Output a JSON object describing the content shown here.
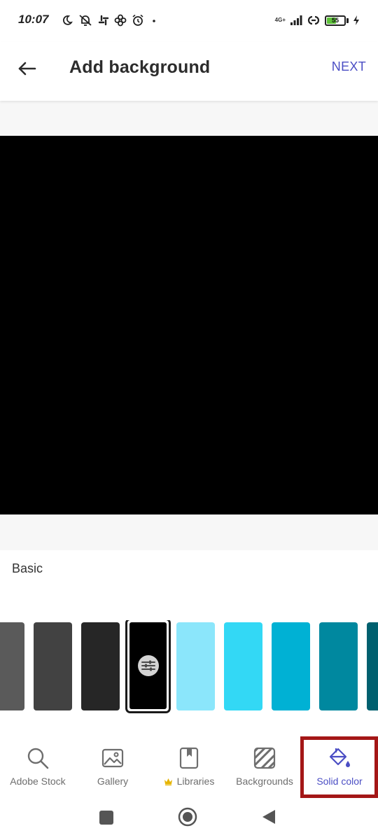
{
  "status_bar": {
    "time": "10:07",
    "network_label": "4G+",
    "battery_level": "55",
    "battery_fraction": 0.55,
    "icons": [
      "moon-icon",
      "muted-vibrate-icon",
      "slack-icon",
      "game-icon",
      "alarm-icon",
      "dot-icon",
      "signal-icon",
      "link-icon",
      "battery-icon",
      "charging-icon"
    ]
  },
  "app_bar": {
    "title": "Add background",
    "next_label": "NEXT",
    "back_icon": "arrow-left-icon"
  },
  "canvas": {
    "background_color": "#000000"
  },
  "panel": {
    "section_label": "Basic",
    "swatches": [
      {
        "color": "#5a5a5a",
        "selected": false
      },
      {
        "color": "#424242",
        "selected": false
      },
      {
        "color": "#262626",
        "selected": false
      },
      {
        "color": "#000000",
        "selected": true,
        "icon": "adjust-sliders-icon"
      },
      {
        "color": "#8be6fb",
        "selected": false
      },
      {
        "color": "#33d8f5",
        "selected": false
      },
      {
        "color": "#00b1d4",
        "selected": false
      },
      {
        "color": "#00889f",
        "selected": false
      },
      {
        "color": "#00606f",
        "selected": false
      }
    ]
  },
  "bottom_nav": {
    "items": [
      {
        "label": "Adobe Stock",
        "icon": "search-icon",
        "active": false
      },
      {
        "label": "Gallery",
        "icon": "image-icon",
        "active": false
      },
      {
        "label": "Libraries",
        "icon": "library-icon",
        "badge_icon": "crown-icon",
        "active": false
      },
      {
        "label": "Backgrounds",
        "icon": "pattern-icon",
        "active": false
      },
      {
        "label": "Solid color",
        "icon": "paint-bucket-icon",
        "active": true
      }
    ],
    "accent_color": "#4b4ec4",
    "highlight_color": "#a41717"
  },
  "system_nav": {
    "buttons": [
      "recents-square-icon",
      "home-circle-icon",
      "back-triangle-icon"
    ]
  }
}
